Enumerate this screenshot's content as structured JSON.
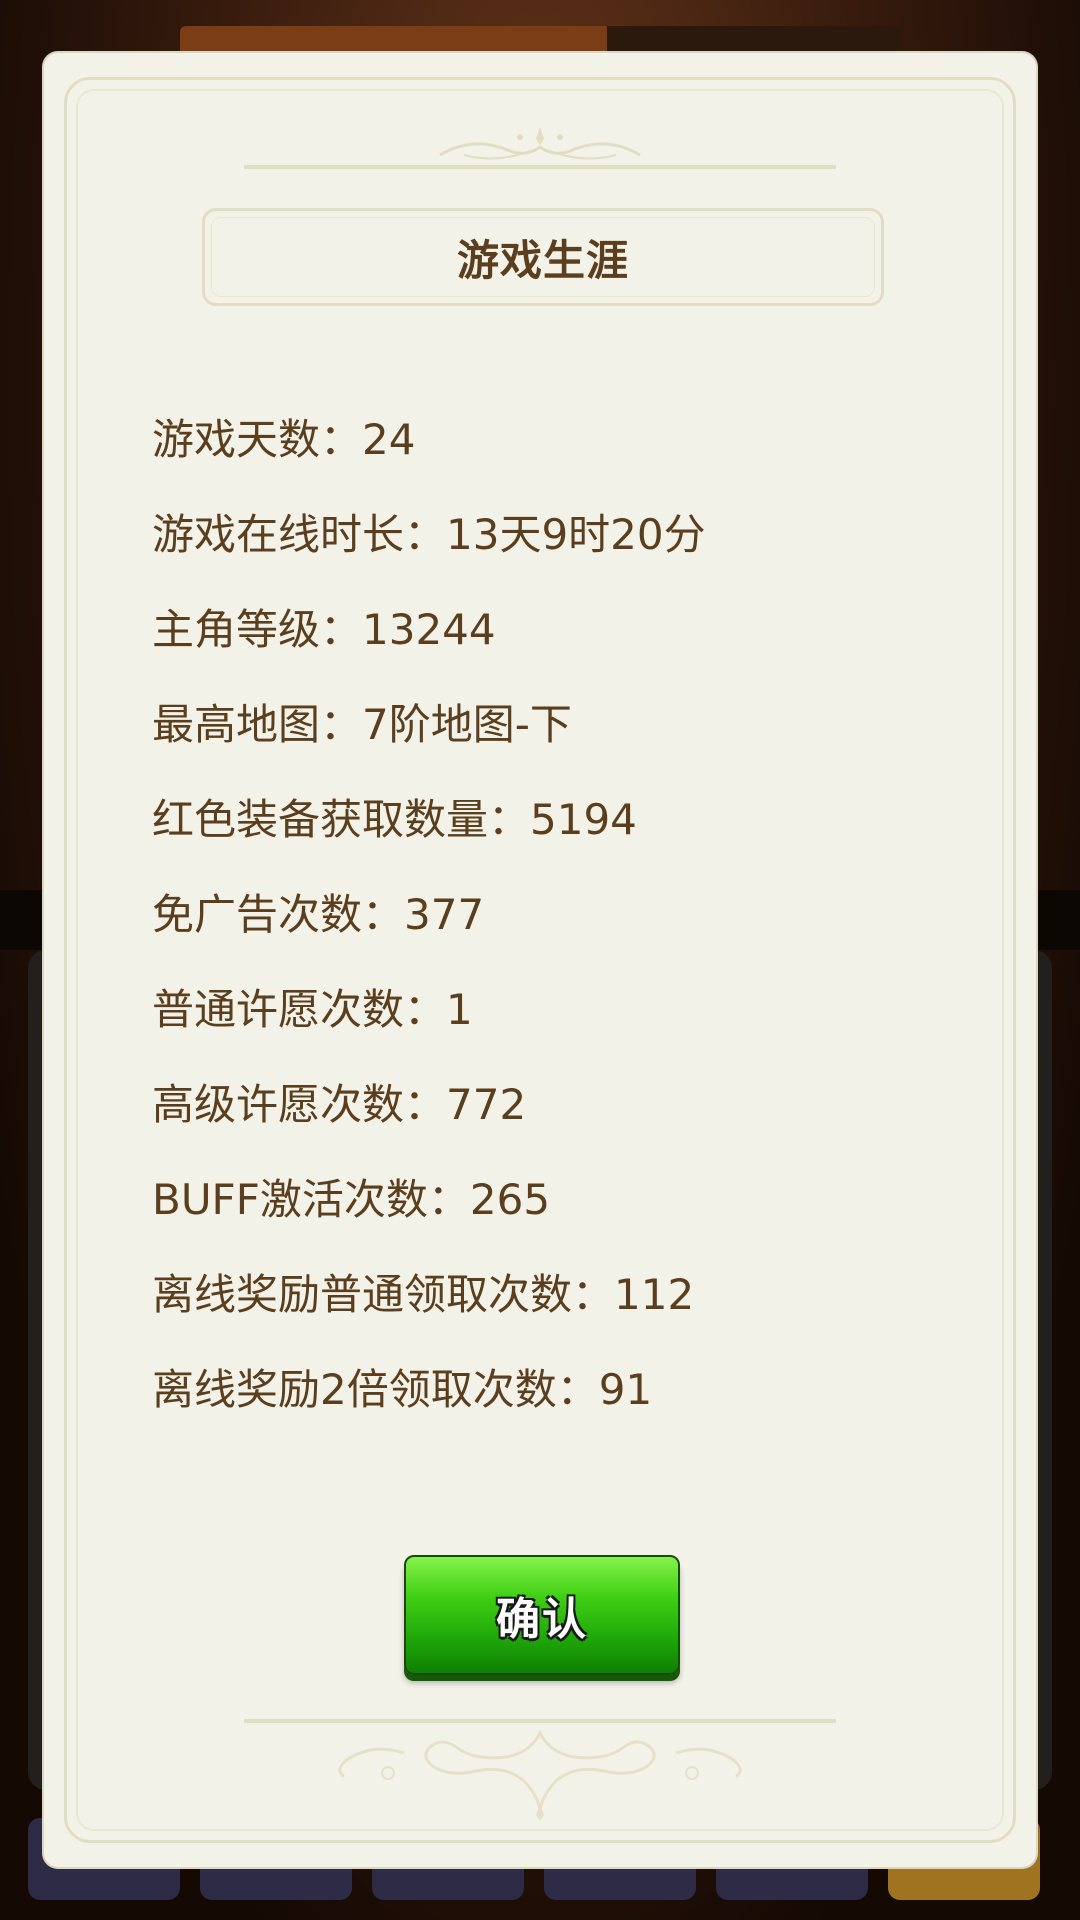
{
  "dialog": {
    "title": "游戏生涯",
    "stats": [
      {
        "label": "游戏天数：",
        "value": "24"
      },
      {
        "label": "游戏在线时长：",
        "value": "13天9时20分"
      },
      {
        "label": "主角等级：",
        "value": "13244"
      },
      {
        "label": "最高地图：",
        "value": "7阶地图-下"
      },
      {
        "label": "红色装备获取数量：",
        "value": "5194"
      },
      {
        "label": "免广告次数：",
        "value": "377"
      },
      {
        "label": "普通许愿次数：",
        "value": "1"
      },
      {
        "label": "高级许愿次数：",
        "value": "772"
      },
      {
        "label": "BUFF激活次数：",
        "value": "265"
      },
      {
        "label": "离线奖励普通领取次数：",
        "value": "112"
      },
      {
        "label": "离线奖励2倍领取次数：",
        "value": "91"
      }
    ],
    "confirm_label": "确认"
  },
  "colors": {
    "panel_bg": "#f3f2e8",
    "text": "#5a3e1e",
    "frame": "#e2dcc2",
    "button_green": "#3fcf14"
  }
}
